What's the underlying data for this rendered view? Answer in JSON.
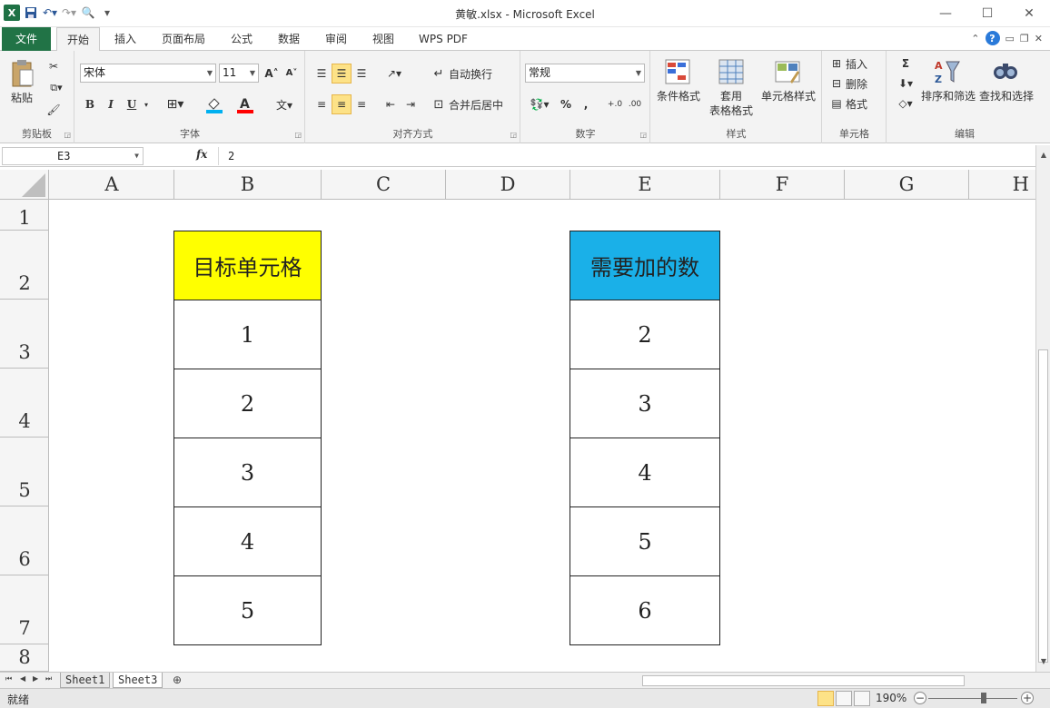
{
  "window": {
    "title": "黄敏.xlsx - Microsoft Excel",
    "minimize": "—",
    "maximize": "☐",
    "close": "✕"
  },
  "ribbon_tabs": [
    "文件",
    "开始",
    "插入",
    "页面布局",
    "公式",
    "数据",
    "审阅",
    "视图",
    "WPS PDF"
  ],
  "ribbon": {
    "clipboard": {
      "label": "剪贴板",
      "paste": "粘贴"
    },
    "font": {
      "label": "字体",
      "name": "宋体",
      "size": "11",
      "bold": "B",
      "italic": "I",
      "underline": "U",
      "grow": "A˄",
      "shrink": "A˅",
      "color_accent": "#ff0000",
      "fill_accent": "#00b0f0"
    },
    "alignment": {
      "label": "对齐方式",
      "wrap": "自动换行",
      "merge": "合并后居中"
    },
    "number": {
      "label": "数字",
      "format": "常规",
      "percent": "%",
      "comma": ","
    },
    "styles": {
      "label": "样式",
      "conditional": "条件格式",
      "table_a": "套用",
      "table_b": "表格格式",
      "cell_styles": "单元格样式"
    },
    "cells": {
      "label": "单元格",
      "insert": "插入",
      "delete": "删除",
      "format": "格式"
    },
    "editing": {
      "label": "编辑",
      "sigma": "Σ",
      "sort": "排序和筛选",
      "find": "查找和选择"
    }
  },
  "formula_bar": {
    "name_box": "E3",
    "fx": "fx",
    "value": "2"
  },
  "columns": [
    "A",
    "B",
    "C",
    "D",
    "E",
    "F",
    "G",
    "H"
  ],
  "rows": [
    "1",
    "2",
    "3",
    "4",
    "5",
    "6",
    "7",
    "8"
  ],
  "table_left": {
    "header": "目标单元格",
    "header_color": "#ffff00",
    "values": [
      "1",
      "2",
      "3",
      "4",
      "5"
    ]
  },
  "table_right": {
    "header": "需要加的数",
    "header_color": "#1ab0e8",
    "values": [
      "2",
      "3",
      "4",
      "5",
      "6"
    ]
  },
  "sheets": [
    "Sheet1",
    "Sheet3"
  ],
  "active_sheet": "Sheet3",
  "status": {
    "ready": "就绪",
    "zoom": "190%"
  }
}
